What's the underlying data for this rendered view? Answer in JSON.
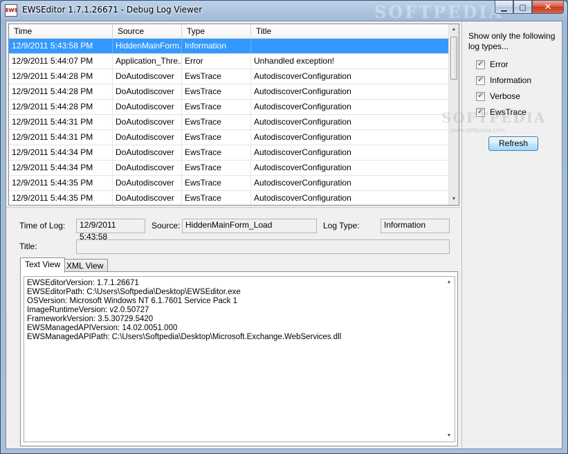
{
  "window": {
    "title": "EWSEditor 1.7.1.26671 - Debug Log Viewer",
    "icon": "ews-app-icon",
    "icon_text": "EWS"
  },
  "watermark": {
    "title": "SOFTPEDIA",
    "side": "SOFTPEDIA",
    "url": "www.softpedia.com"
  },
  "caption_buttons": {
    "minimize": "▁",
    "maximize": "▢",
    "close": "✕"
  },
  "grid": {
    "columns": [
      "Time",
      "Source",
      "Type",
      "Title"
    ],
    "rows": [
      {
        "time": "12/9/2011 5:43:58 PM",
        "source": "HiddenMainForm...",
        "type": "Information",
        "title": ""
      },
      {
        "time": "12/9/2011 5:44:07 PM",
        "source": "Application_Thre...",
        "type": "Error",
        "title": "Unhandled exception!"
      },
      {
        "time": "12/9/2011 5:44:28 PM",
        "source": "DoAutodiscover",
        "type": "EwsTrace",
        "title": "AutodiscoverConfiguration"
      },
      {
        "time": "12/9/2011 5:44:28 PM",
        "source": "DoAutodiscover",
        "type": "EwsTrace",
        "title": "AutodiscoverConfiguration"
      },
      {
        "time": "12/9/2011 5:44:28 PM",
        "source": "DoAutodiscover",
        "type": "EwsTrace",
        "title": "AutodiscoverConfiguration"
      },
      {
        "time": "12/9/2011 5:44:31 PM",
        "source": "DoAutodiscover",
        "type": "EwsTrace",
        "title": "AutodiscoverConfiguration"
      },
      {
        "time": "12/9/2011 5:44:31 PM",
        "source": "DoAutodiscover",
        "type": "EwsTrace",
        "title": "AutodiscoverConfiguration"
      },
      {
        "time": "12/9/2011 5:44:34 PM",
        "source": "DoAutodiscover",
        "type": "EwsTrace",
        "title": "AutodiscoverConfiguration"
      },
      {
        "time": "12/9/2011 5:44:34 PM",
        "source": "DoAutodiscover",
        "type": "EwsTrace",
        "title": "AutodiscoverConfiguration"
      },
      {
        "time": "12/9/2011 5:44:35 PM",
        "source": "DoAutodiscover",
        "type": "EwsTrace",
        "title": "AutodiscoverConfiguration"
      },
      {
        "time": "12/9/2011 5:44:35 PM",
        "source": "DoAutodiscover",
        "type": "EwsTrace",
        "title": "AutodiscoverConfiguration"
      }
    ],
    "selected_index": 0
  },
  "filter": {
    "caption": "Show only the following log types...",
    "options": [
      {
        "label": "Error",
        "checked": true
      },
      {
        "label": "Information",
        "checked": true
      },
      {
        "label": "Verbose",
        "checked": true
      },
      {
        "label": "EwsTrace",
        "checked": true
      }
    ],
    "refresh_label": "Refresh"
  },
  "details": {
    "time_label": "Time of Log:",
    "time_value": "12/9/2011 5:43:58",
    "source_label": "Source:",
    "source_value": "HiddenMainForm_Load",
    "type_label": "Log Type:",
    "type_value": "Information",
    "title_label": "Title:",
    "title_value": ""
  },
  "tabs": [
    {
      "label": "Text View",
      "active": true
    },
    {
      "label": "XML View",
      "active": false
    }
  ],
  "log_text": [
    "EWSEditorVersion: 1.7.1.26671",
    "EWSEditorPath: C:\\Users\\Softpedia\\Desktop\\EWSEditor.exe",
    "OSVersion: Microsoft Windows NT 6.1.7601 Service Pack 1",
    "ImageRuntimeVersion: v2.0.50727",
    "FrameworkVersion: 3.5.30729.5420",
    "EWSManagedAPIVersion: 14.02.0051.000",
    "EWSManagedAPIPath: C:\\Users\\Softpedia\\Desktop\\Microsoft.Exchange.WebServices.dll"
  ]
}
